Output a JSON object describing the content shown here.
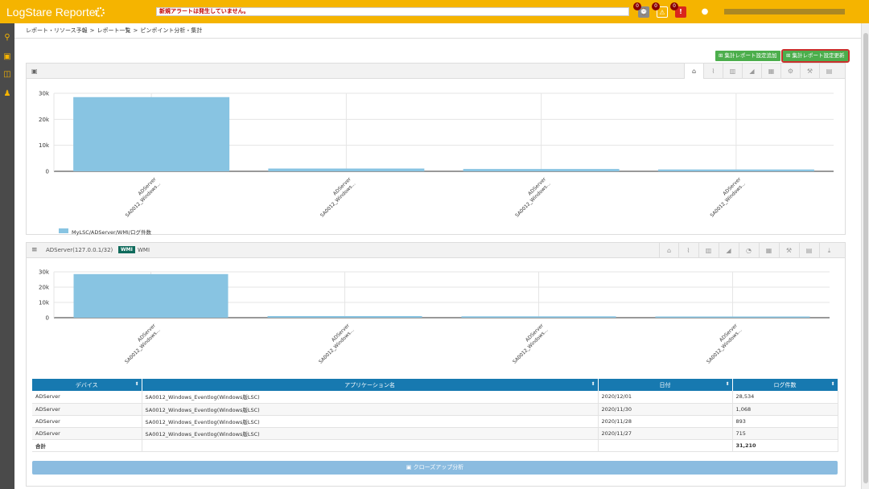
{
  "app": {
    "title": "LogStare Reporter"
  },
  "header": {
    "alert_message": "新規アラートは発生していません。",
    "badges": [
      {
        "icon": "clock-icon",
        "count": "0",
        "color": "#8a8a8a"
      },
      {
        "icon": "warning-icon",
        "count": "0",
        "color": "#f5b400"
      },
      {
        "icon": "error-icon",
        "count": "0",
        "color": "#d9261c"
      }
    ],
    "help_icon": "help-icon"
  },
  "sidebar": {
    "items": [
      "search-icon",
      "image-icon",
      "tag-icon",
      "users-icon"
    ]
  },
  "breadcrumb": [
    "レポート・リソース予報",
    "レポート一覧",
    "ピンポイント分析・集計"
  ],
  "buttons": {
    "add": "集計レポート設定追加",
    "update": "集計レポート設定更新",
    "closeup": "クローズアップ分析"
  },
  "chart_panel": {
    "toolbar": [
      "home-icon",
      "line-chart-icon",
      "bar-chart-icon",
      "area-chart-icon",
      "grid-icon",
      "settings-icon",
      "wrench-icon",
      "document-icon"
    ],
    "legend": "MyLSC/ADServer/WMI/ログ件数"
  },
  "detail_panel": {
    "device": "ADServer(127.0.0.1/32)",
    "tag": "WMI",
    "type": "WMI",
    "toolbar": [
      "home-icon",
      "line-chart-icon",
      "bar-chart-icon",
      "area-chart-icon",
      "pie-chart-icon",
      "grid-icon",
      "wrench-icon",
      "document-icon",
      "download-icon"
    ]
  },
  "chart_data": [
    {
      "type": "bar",
      "categories": [
        "ADServer SA0012_Windows...",
        "ADServer SA0012_Windows...",
        "ADServer SA0012_Windows...",
        "ADServer SA0012_Windows..."
      ],
      "category_lines": [
        [
          "ADServer",
          "SA0012_Windows..."
        ],
        [
          "ADServer",
          "SA0012_Windows..."
        ],
        [
          "ADServer",
          "SA0012_Windows..."
        ],
        [
          "ADServer",
          "SA0012_Windows..."
        ]
      ],
      "series": [
        {
          "name": "MyLSC/ADServer/WMI/ログ件数",
          "values": [
            28534,
            1068,
            893,
            715
          ]
        }
      ],
      "ylim": [
        0,
        30000
      ],
      "yticks": [
        "0",
        "10k",
        "20k",
        "30k"
      ],
      "color": "#88c4e2",
      "grid": true,
      "legend": "bottom-left"
    },
    {
      "type": "bar",
      "categories": [
        "ADServer SA0012_Windows...",
        "ADServer SA0012_Windows...",
        "ADServer SA0012_Windows...",
        "ADServer SA0012_Windows..."
      ],
      "category_lines": [
        [
          "ADServer",
          "SA0012_Windows..."
        ],
        [
          "ADServer",
          "SA0012_Windows..."
        ],
        [
          "ADServer",
          "SA0012_Windows..."
        ],
        [
          "ADServer",
          "SA0012_Windows..."
        ]
      ],
      "series": [
        {
          "values": [
            28534,
            1068,
            893,
            715
          ]
        }
      ],
      "ylim": [
        0,
        30000
      ],
      "yticks": [
        "0",
        "10k",
        "20k",
        "30k"
      ],
      "color": "#88c4e2",
      "grid": true
    }
  ],
  "table": {
    "columns": [
      "デバイス",
      "アプリケーション名",
      "日付",
      "ログ件数"
    ],
    "rows": [
      [
        "ADServer",
        "SA0012_Windows_Eventlog(Windows版LSC)",
        "2020/12/01",
        "28,534"
      ],
      [
        "ADServer",
        "SA0012_Windows_Eventlog(Windows版LSC)",
        "2020/11/30",
        "1,068"
      ],
      [
        "ADServer",
        "SA0012_Windows_Eventlog(Windows版LSC)",
        "2020/11/28",
        "893"
      ],
      [
        "ADServer",
        "SA0012_Windows_Eventlog(Windows版LSC)",
        "2020/11/27",
        "715"
      ]
    ],
    "total": [
      "合計",
      "",
      "",
      "31,210"
    ]
  }
}
